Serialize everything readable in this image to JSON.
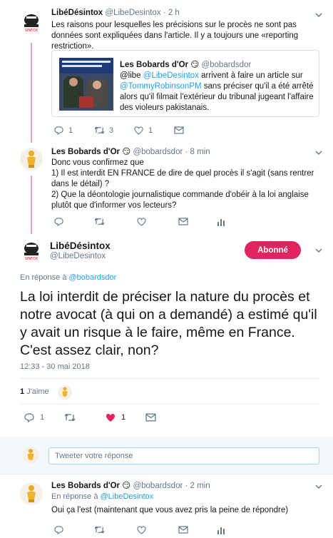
{
  "tweet1": {
    "name": "LibéDésintox",
    "handle": "@LibeDesintox",
    "time": "· 2 h",
    "text": "Les raisons pour lesquelles les précisions sur le procès ne sont pas données sont expliquées dans l'article.  Il y a toujours une «reporting restriction».",
    "quote": {
      "name": "Les Bobards d'Or",
      "emoji": "😏",
      "handle": "@bobardsdor",
      "text_prefix": "@libe ",
      "mention1": "@LibeDesintox",
      "text_mid": " arrivent à faire un article sur ",
      "mention2": "@TommyRobinsonPM",
      "text_suffix": " sans préciser qu'il a été arrêté alors qu'il filmait l'extérieur du tribunal jugeant l'affaire des violeurs pakistanais."
    },
    "actions": {
      "replies": "1",
      "retweets": "3",
      "likes": "1"
    }
  },
  "tweet2": {
    "name": "Les Bobards d'Or",
    "emoji": "😏",
    "handle": "@bobardsdor",
    "time": "· 8 min",
    "line1": "Donc vous confirmez que",
    "line2": "1) Il est interdit EN FRANCE de dire de quel procès il s'agit (sans rentrer dans le détail) ?",
    "line3": "2) Que la déontologie journalistique commande d'obéir à la loi anglaise plutôt que d'informer vos lecteurs?"
  },
  "main": {
    "name": "LibéDésintox",
    "handle": "@LibeDesintox",
    "follow_label": "Abonné",
    "reply_prefix": "En réponse à ",
    "reply_to": "@bobardsdor",
    "text": "La loi interdit de préciser la nature du procès et notre avocat (à qui on a demandé) a estimé qu'il y avait un risque à le faire, même en France. C'est assez clair, non?",
    "timestamp": "12:33 - 30 mai 2018",
    "likes_count": "1",
    "likes_label": "J'aime",
    "actions": {
      "replies": "1",
      "likes": "1"
    }
  },
  "reply_box": {
    "placeholder": "Tweeter votre réponse"
  },
  "tweet3": {
    "name": "Les Bobards d'Or",
    "emoji": "😏",
    "handle": "@bobardsdor",
    "time": "· 2 min",
    "reply_prefix": "En réponse à ",
    "reply_to": "@LibeDesintox",
    "text": "Oui ça l'est (maintenant que vous avez pris la peine de répondre)"
  },
  "colors": {
    "accent": "#1da1f2",
    "like": "#e0245e",
    "muted": "#657786",
    "thread": "#e6a3b6"
  }
}
